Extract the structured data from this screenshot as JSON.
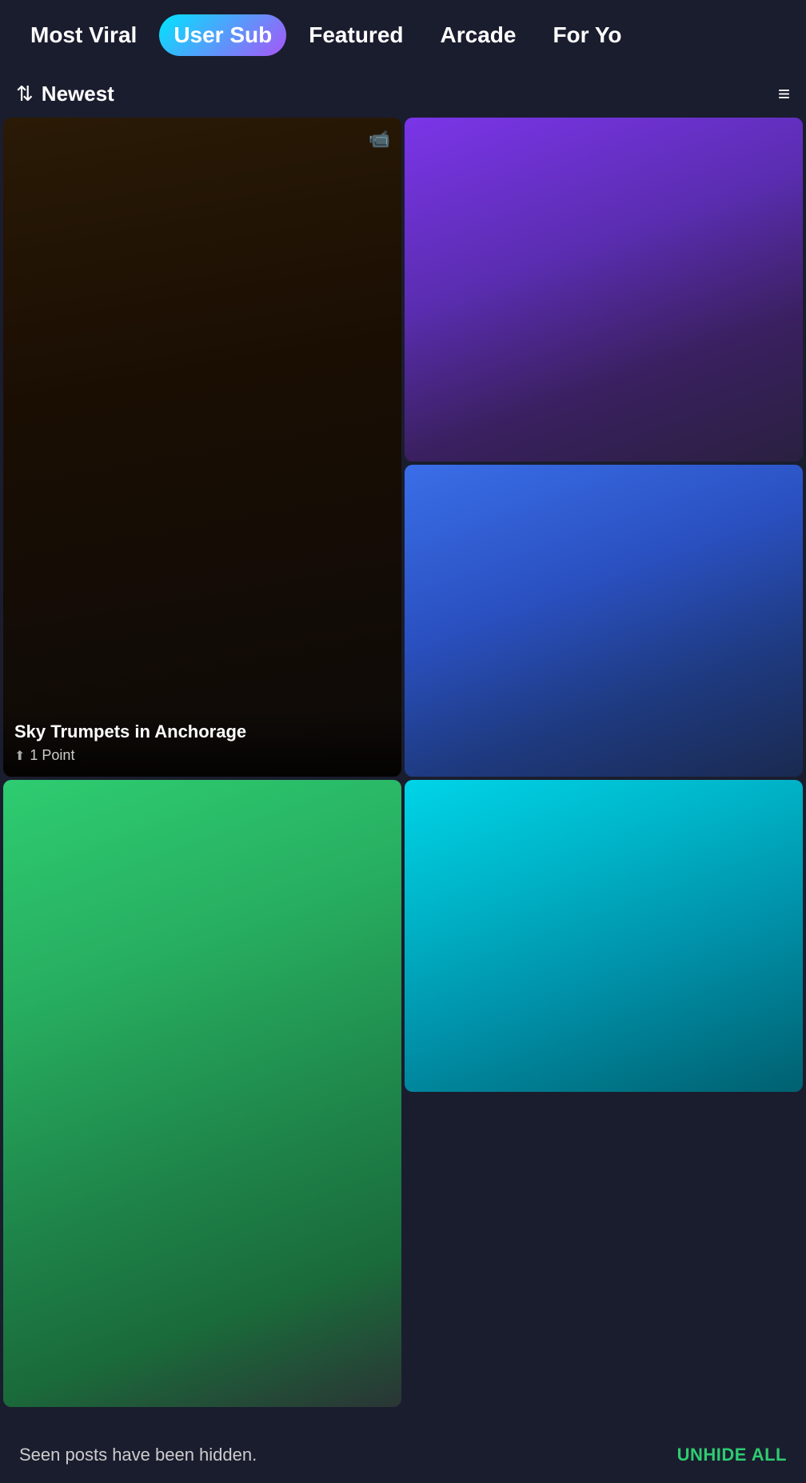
{
  "nav": {
    "items": [
      {
        "id": "most-viral",
        "label": "Most Viral",
        "active": false
      },
      {
        "id": "user-sub",
        "label": "User Sub",
        "active": true
      },
      {
        "id": "featured",
        "label": "Featured",
        "active": false
      },
      {
        "id": "arcade",
        "label": "Arcade",
        "active": false
      },
      {
        "id": "for-you",
        "label": "For Yo",
        "active": false
      }
    ]
  },
  "sort": {
    "icon": "⇅",
    "label": "Newest",
    "filter_icon": "≡"
  },
  "cards": [
    {
      "id": "card-1",
      "title": "Sky Trumpets in Anchorage",
      "points": "1 Point",
      "has_video": true,
      "style": "dark-night"
    },
    {
      "id": "card-2",
      "title": "",
      "points": "",
      "has_video": false,
      "style": "purple"
    },
    {
      "id": "card-3",
      "title": "",
      "points": "",
      "has_video": false,
      "style": "blue"
    },
    {
      "id": "card-4",
      "title": "",
      "points": "",
      "has_video": false,
      "style": "green"
    },
    {
      "id": "card-5",
      "title": "",
      "points": "",
      "has_video": false,
      "style": "cyan"
    }
  ],
  "bottom_bar": {
    "seen_text": "Seen posts have been hidden.",
    "unhide_label": "UNHIDE ALL"
  },
  "colors": {
    "accent_green": "#2ecc71",
    "bg_dark": "#1a1d2e",
    "nav_gradient_start": "#00e5ff",
    "nav_gradient_end": "#a855f7"
  }
}
